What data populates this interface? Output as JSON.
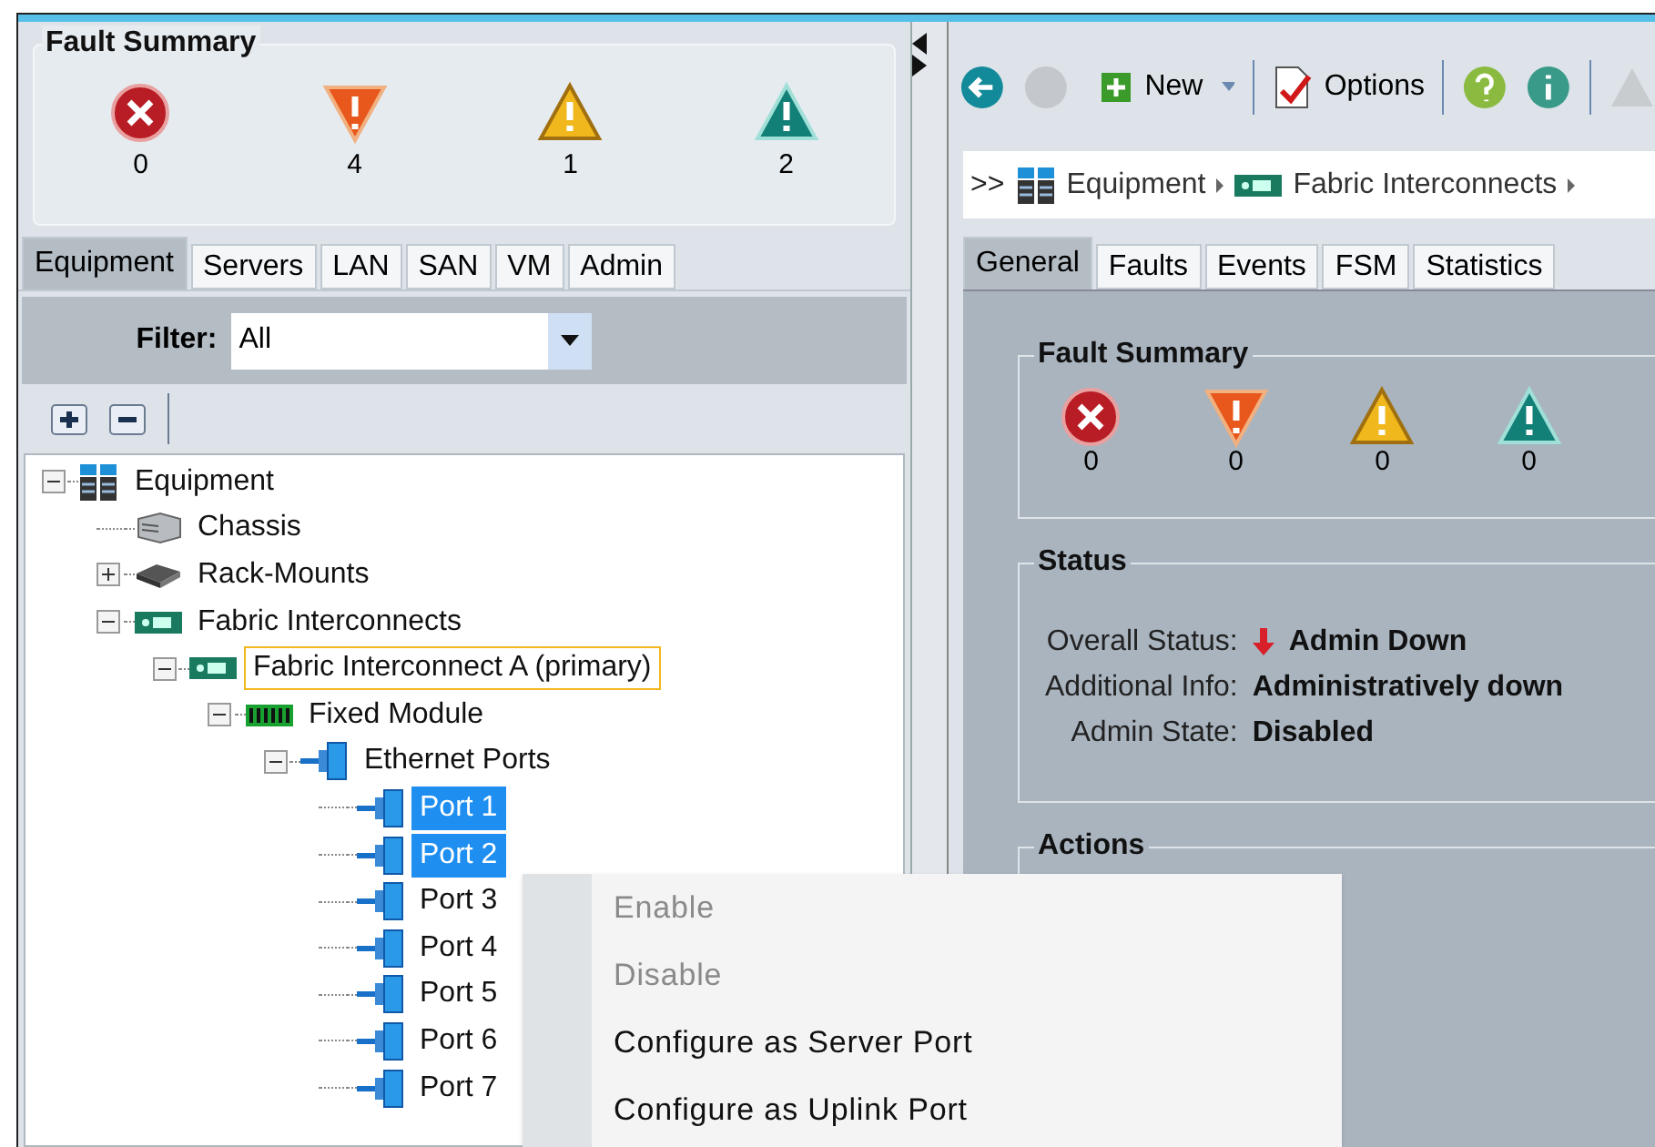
{
  "left": {
    "fault_summary": {
      "title": "Fault Summary",
      "items": [
        {
          "kind": "critical",
          "count": "0"
        },
        {
          "kind": "major",
          "count": "4"
        },
        {
          "kind": "minor",
          "count": "1"
        },
        {
          "kind": "warning",
          "count": "2"
        }
      ]
    },
    "tabs": [
      {
        "label": "Equipment",
        "selected": true
      },
      {
        "label": "Servers",
        "selected": false
      },
      {
        "label": "LAN",
        "selected": false
      },
      {
        "label": "SAN",
        "selected": false
      },
      {
        "label": "VM",
        "selected": false
      },
      {
        "label": "Admin",
        "selected": false
      }
    ],
    "filter": {
      "label": "Filter:",
      "value": "All"
    },
    "tree": [
      {
        "label": "Equipment",
        "kind": "equipment",
        "expanded": true,
        "selected": false,
        "focused": false,
        "children": [
          {
            "label": "Chassis",
            "kind": "chassis",
            "selected": false,
            "focused": false
          },
          {
            "label": "Rack-Mounts",
            "kind": "rack",
            "expanded": false,
            "selected": false,
            "focused": false
          },
          {
            "label": "Fabric Interconnects",
            "kind": "fi",
            "expanded": true,
            "selected": false,
            "focused": false,
            "children": [
              {
                "label": "Fabric Interconnect A (primary)",
                "kind": "fi",
                "expanded": true,
                "selected": false,
                "focused": true,
                "children": [
                  {
                    "label": "Fixed Module",
                    "kind": "module",
                    "expanded": true,
                    "selected": false,
                    "focused": false,
                    "children": [
                      {
                        "label": "Ethernet Ports",
                        "kind": "port",
                        "expanded": true,
                        "selected": false,
                        "focused": false,
                        "children": [
                          {
                            "label": "Port 1",
                            "kind": "port",
                            "selected": true,
                            "focused": false
                          },
                          {
                            "label": "Port 2",
                            "kind": "port",
                            "selected": true,
                            "focused": false
                          },
                          {
                            "label": "Port 3",
                            "kind": "port",
                            "selected": false,
                            "focused": false
                          },
                          {
                            "label": "Port 4",
                            "kind": "port",
                            "selected": false,
                            "focused": false
                          },
                          {
                            "label": "Port 5",
                            "kind": "port",
                            "selected": false,
                            "focused": false
                          },
                          {
                            "label": "Port 6",
                            "kind": "port",
                            "selected": false,
                            "focused": false
                          },
                          {
                            "label": "Port 7",
                            "kind": "port",
                            "selected": false,
                            "focused": false
                          }
                        ]
                      }
                    ]
                  }
                ]
              }
            ]
          }
        ]
      }
    ]
  },
  "context_menu": [
    {
      "label": "Enable",
      "disabled": true
    },
    {
      "label": "Disable",
      "disabled": true
    },
    {
      "label": "Configure as Server Port",
      "disabled": false
    },
    {
      "label": "Configure as Uplink Port",
      "disabled": false
    }
  ],
  "right": {
    "toolbar": {
      "new": "New",
      "options": "Options"
    },
    "breadcrumb": {
      "prefix": ">>",
      "items": [
        {
          "label": "Equipment",
          "kind": "equipment"
        },
        {
          "label": "Fabric Interconnects",
          "kind": "fi"
        }
      ]
    },
    "tabs": [
      {
        "label": "General",
        "selected": true
      },
      {
        "label": "Faults",
        "selected": false
      },
      {
        "label": "Events",
        "selected": false
      },
      {
        "label": "FSM",
        "selected": false
      },
      {
        "label": "Statistics",
        "selected": false
      }
    ],
    "fault_summary": {
      "title": "Fault Summary",
      "items": [
        {
          "kind": "critical",
          "count": "0"
        },
        {
          "kind": "major",
          "count": "0"
        },
        {
          "kind": "minor",
          "count": "0"
        },
        {
          "kind": "warning",
          "count": "0"
        }
      ]
    },
    "status": {
      "title": "Status",
      "fields": [
        {
          "label": "Overall Status:",
          "value": "Admin Down",
          "down": true
        },
        {
          "label": "Additional Info:",
          "value": "Administratively down",
          "down": false
        },
        {
          "label": "Admin State:",
          "value": "Disabled",
          "down": false
        }
      ]
    },
    "actions": {
      "title": "Actions"
    }
  }
}
